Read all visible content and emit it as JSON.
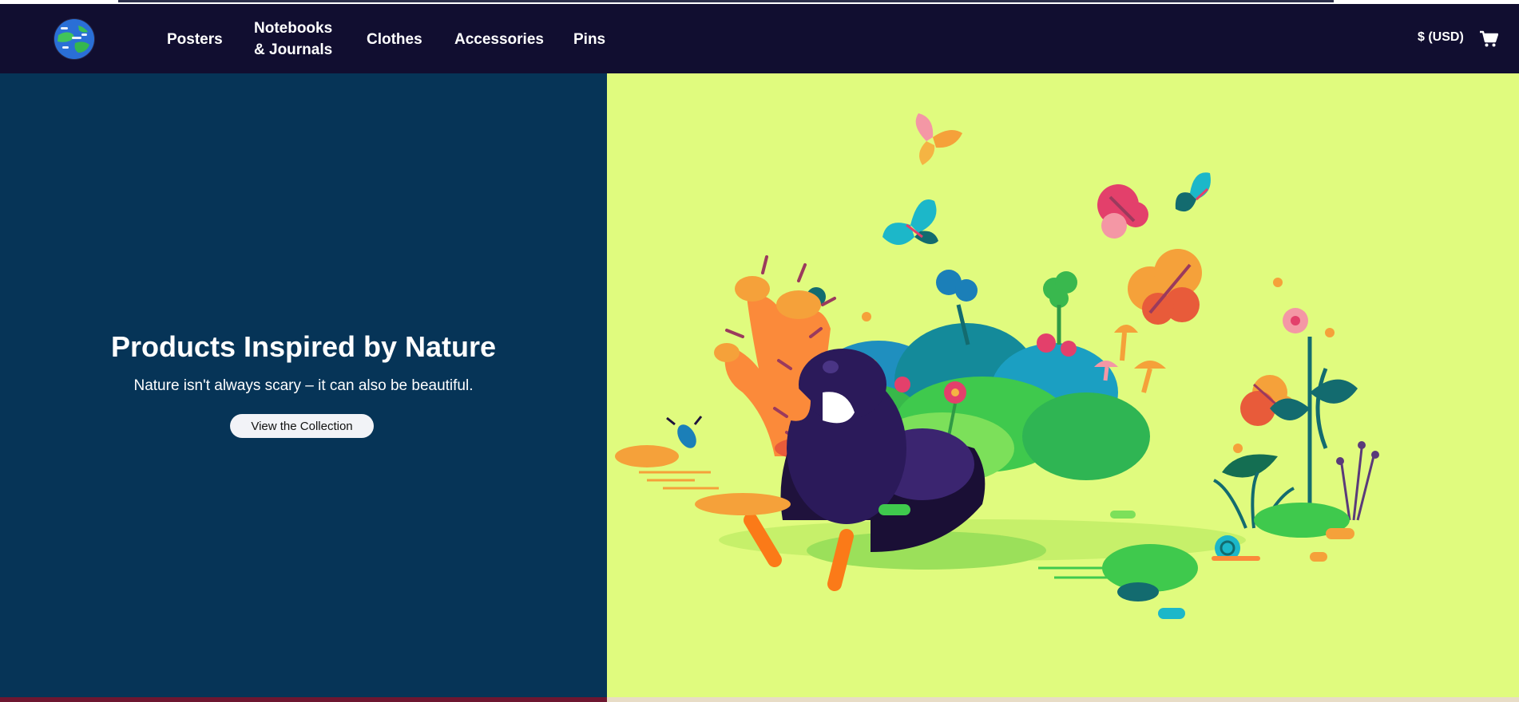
{
  "nav": {
    "logo_icon": "earth-globe-logo-icon",
    "links": [
      {
        "label": "Posters"
      },
      {
        "label": "Notebooks\n& Journals"
      },
      {
        "label": "Clothes"
      },
      {
        "label": "Accessories"
      },
      {
        "label": "Pins"
      }
    ],
    "currency": "$ (USD)",
    "cart_icon": "shopping-cart-icon"
  },
  "hero": {
    "title": "Products Inspired by Nature",
    "subtitle": "Nature isn't always scary – it can also be beautiful.",
    "button_label": "View the Collection",
    "illustration": "bird-in-garden-illustration"
  },
  "colors": {
    "nav_bg": "#110e30",
    "hero_left_bg": "#063457",
    "hero_right_bg": "#e0fb7e",
    "button_bg": "#f2f3f7"
  }
}
